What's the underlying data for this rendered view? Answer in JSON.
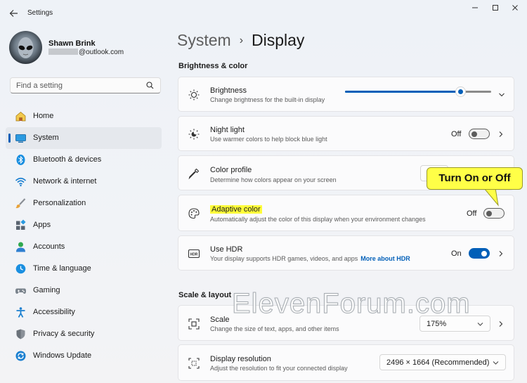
{
  "window": {
    "title": "Settings"
  },
  "profile": {
    "name": "Shawn Brink",
    "email_suffix": "@outlook.com"
  },
  "search": {
    "placeholder": "Find a setting"
  },
  "nav": {
    "items": [
      {
        "label": "Home",
        "icon": "home-icon",
        "selected": false
      },
      {
        "label": "System",
        "icon": "system-icon",
        "selected": true
      },
      {
        "label": "Bluetooth & devices",
        "icon": "bluetooth-icon",
        "selected": false
      },
      {
        "label": "Network & internet",
        "icon": "wifi-icon",
        "selected": false
      },
      {
        "label": "Personalization",
        "icon": "brush-icon",
        "selected": false
      },
      {
        "label": "Apps",
        "icon": "apps-icon",
        "selected": false
      },
      {
        "label": "Accounts",
        "icon": "person-icon",
        "selected": false
      },
      {
        "label": "Time & language",
        "icon": "clock-globe-icon",
        "selected": false
      },
      {
        "label": "Gaming",
        "icon": "gamepad-icon",
        "selected": false
      },
      {
        "label": "Accessibility",
        "icon": "accessibility-icon",
        "selected": false
      },
      {
        "label": "Privacy & security",
        "icon": "shield-icon",
        "selected": false
      },
      {
        "label": "Windows Update",
        "icon": "update-icon",
        "selected": false
      }
    ]
  },
  "breadcrumb": {
    "parent": "System",
    "current": "Display"
  },
  "sections": {
    "brightness_color": "Brightness & color",
    "scale_layout": "Scale & layout"
  },
  "settings": {
    "brightness": {
      "title": "Brightness",
      "desc": "Change brightness for the built-in display",
      "level_percent": 79
    },
    "night_light": {
      "title": "Night light",
      "desc": "Use warmer colors to help block blue light",
      "state": "Off"
    },
    "color_profile": {
      "title": "Color profile",
      "desc": "Determine how colors appear on your screen"
    },
    "adaptive_color": {
      "title": "Adaptive color",
      "desc": "Automatically adjust the color of this display when your environment changes",
      "state": "Off"
    },
    "hdr": {
      "title": "Use HDR",
      "desc": "Your display supports HDR games, videos, and apps",
      "link": "More about HDR",
      "state": "On"
    },
    "scale": {
      "title": "Scale",
      "desc": "Change the size of text, apps, and other items",
      "value": "175%"
    },
    "resolution": {
      "title": "Display resolution",
      "desc": "Adjust the resolution to fit your connected display",
      "value": "2496 × 1664 (Recommended)"
    }
  },
  "callout": {
    "text": "Turn On or Off",
    "color": "#ffff47"
  },
  "watermark": {
    "text": "ElevenForum.com"
  },
  "colors": {
    "accent": "#005fb8",
    "highlight": "#fffd3a"
  }
}
